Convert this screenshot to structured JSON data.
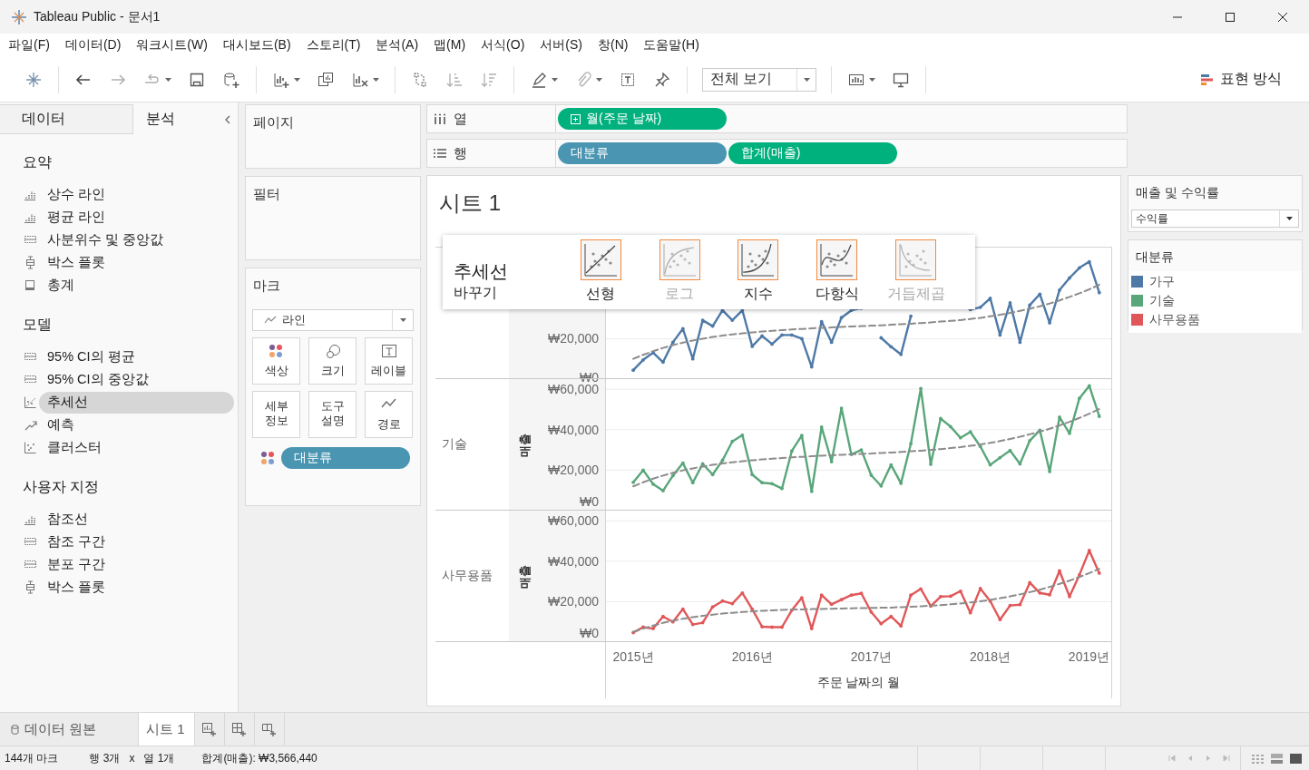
{
  "window": {
    "title": "Tableau Public - 문서1"
  },
  "menu": [
    {
      "label": "파일(F)"
    },
    {
      "label": "데이터(D)"
    },
    {
      "label": "워크시트(W)"
    },
    {
      "label": "대시보드(B)"
    },
    {
      "label": "스토리(T)"
    },
    {
      "label": "분석(A)"
    },
    {
      "label": "맵(M)"
    },
    {
      "label": "서식(O)"
    },
    {
      "label": "서버(S)"
    },
    {
      "label": "창(N)"
    },
    {
      "label": "도움말(H)"
    }
  ],
  "toolbar": {
    "view_dropdown": "전체 보기",
    "show_me": "표현 방식"
  },
  "side_tabs": [
    {
      "label": "데이터",
      "selected": false
    },
    {
      "label": "분석",
      "selected": true
    }
  ],
  "analytics": {
    "sections": [
      {
        "title": "요약",
        "items": [
          {
            "label": "상수 라인",
            "kind": "line",
            "selected": false
          },
          {
            "label": "평균 라인",
            "kind": "line",
            "selected": false
          },
          {
            "label": "사분위수 및 중앙값",
            "kind": "band",
            "selected": false
          },
          {
            "label": "박스 플롯",
            "kind": "box",
            "selected": false
          },
          {
            "label": "총계",
            "kind": "total",
            "selected": false
          }
        ]
      },
      {
        "title": "모델",
        "items": [
          {
            "label": "95% CI의 평균",
            "kind": "band",
            "selected": false
          },
          {
            "label": "95% CI의 중앙값",
            "kind": "band",
            "selected": false
          },
          {
            "label": "추세선",
            "kind": "trend",
            "selected": true
          },
          {
            "label": "예측",
            "kind": "forecast",
            "selected": false
          },
          {
            "label": "클러스터",
            "kind": "cluster",
            "selected": false
          }
        ]
      },
      {
        "title": "사용자 지정",
        "items": [
          {
            "label": "참조선",
            "kind": "line",
            "selected": false
          },
          {
            "label": "참조 구간",
            "kind": "band",
            "selected": false
          },
          {
            "label": "분포 구간",
            "kind": "band",
            "selected": false
          },
          {
            "label": "박스 플롯",
            "kind": "box",
            "selected": false
          }
        ]
      }
    ]
  },
  "pages": {
    "title": "페이지"
  },
  "filters": {
    "title": "필터"
  },
  "marks": {
    "title": "마크",
    "mark_type": "라인",
    "buttons": [
      {
        "label": "색상",
        "kind": "color"
      },
      {
        "label": "크기",
        "kind": "size"
      },
      {
        "label": "레이블",
        "kind": "label"
      },
      {
        "label": "세부\n정보",
        "kind": "detail"
      },
      {
        "label": "도구\n설명",
        "kind": "tooltip"
      },
      {
        "label": "경로",
        "kind": "path"
      }
    ],
    "pills": [
      {
        "label": "대분류",
        "kind": "discrete"
      }
    ]
  },
  "columns_shelf": {
    "label": "열",
    "pills": [
      {
        "label": "월(주문 날짜)",
        "kind": "continuous",
        "expandable": true
      }
    ]
  },
  "rows_shelf": {
    "label": "행",
    "pills": [
      {
        "label": "대분류",
        "kind": "discrete",
        "expandable": false
      },
      {
        "label": "합계(매출)",
        "kind": "continuous",
        "expandable": false
      }
    ]
  },
  "view": {
    "title": "시트 1",
    "panes": [
      {
        "chart_data": {
          "type": "line",
          "x": [
            2015,
            2015.083,
            2015.167,
            2015.25,
            2015.333,
            2015.417,
            2015.5,
            2015.583,
            2015.667,
            2015.75,
            2015.833,
            2015.917,
            2016,
            2016.083,
            2016.167,
            2016.25,
            2016.333,
            2016.417,
            2016.5,
            2016.583,
            2016.667,
            2016.75,
            2016.833,
            2016.917,
            2017,
            2017.083,
            2017.167,
            2017.25,
            2017.333,
            2017.417,
            2017.5,
            2017.583,
            2017.667,
            2017.75,
            2017.833,
            2017.917,
            2018,
            2018.083,
            2018.167,
            2018.25,
            2018.333,
            2018.417,
            2018.5,
            2018.583,
            2018.667,
            2018.75,
            2018.833,
            2018.917
          ],
          "xlim": [
            2014.763,
            2019.025
          ],
          "ylim": [
            0,
            65000
          ],
          "grid": true,
          "yticks": [
            {
              "value": 0,
              "label": "₩0"
            },
            {
              "value": 20000,
              "label": "₩20,000"
            }
          ],
          "series": [
            {
              "color": "#4e79a7",
              "line_style": "solid",
              "values": [
                4400,
                9500,
                13100,
                8400,
                18200,
                24900,
                10000,
                29100,
                26200,
                34000,
                29100,
                34000,
                16200,
                21300,
                17300,
                21800,
                21800,
                20000,
                6000,
                28400,
                18200,
                30400,
                34000,
                35000,
                null,
                20400,
                16000,
                12200,
                31100,
                null,
                null,
                null,
                null,
                null,
                34400,
                35500,
                40000,
                21800,
                37700,
                18200,
                36600,
                42000,
                27800,
                44000,
                50000,
                55000,
                58000,
                42700
              ]
            },
            {
              "color": "#8c8c8c",
              "line_style": "dashed",
              "values": [
                10000,
                12000,
                13800,
                15400,
                16800,
                18000,
                19100,
                20000,
                20800,
                21500,
                22100,
                22600,
                23100,
                23500,
                23900,
                24200,
                24500,
                24800,
                25100,
                25300,
                25500,
                25800,
                26000,
                26200,
                26400,
                26600,
                26900,
                27100,
                27400,
                27700,
                28000,
                28400,
                28800,
                29200,
                29700,
                30300,
                31000,
                31800,
                32700,
                33700,
                34800,
                36000,
                37400,
                38900,
                40600,
                42400,
                44400,
                46600
              ]
            }
          ]
        }
      },
      {
        "label": "기술",
        "chart_data": {
          "type": "line",
          "ylabel": "매출",
          "x": [
            2015,
            2015.083,
            2015.167,
            2015.25,
            2015.333,
            2015.417,
            2015.5,
            2015.583,
            2015.667,
            2015.75,
            2015.833,
            2015.917,
            2016,
            2016.083,
            2016.167,
            2016.25,
            2016.333,
            2016.417,
            2016.5,
            2016.583,
            2016.667,
            2016.75,
            2016.833,
            2016.917,
            2017,
            2017.083,
            2017.167,
            2017.25,
            2017.333,
            2017.417,
            2017.5,
            2017.583,
            2017.667,
            2017.75,
            2017.833,
            2017.917,
            2018,
            2018.083,
            2018.167,
            2018.25,
            2018.333,
            2018.417,
            2018.5,
            2018.583,
            2018.667,
            2018.75,
            2018.833,
            2018.917
          ],
          "xlim": [
            2014.763,
            2019.025
          ],
          "ylim": [
            0,
            65000
          ],
          "grid": true,
          "yticks": [
            {
              "value": 0,
              "label": "₩0"
            },
            {
              "value": 20000,
              "label": "₩20,000"
            },
            {
              "value": 40000,
              "label": "₩40,000"
            },
            {
              "value": 60000,
              "label": "₩60,000"
            }
          ],
          "series": [
            {
              "color": "#59a67a",
              "line_style": "solid",
              "values": [
                14000,
                20000,
                13100,
                9800,
                17300,
                23500,
                13800,
                23100,
                17800,
                24900,
                34200,
                37300,
                17800,
                13800,
                13300,
                10900,
                29500,
                37100,
                9500,
                41300,
                24200,
                50600,
                27800,
                30000,
                17500,
                12200,
                22600,
                13500,
                33100,
                60400,
                22900,
                45500,
                41500,
                36000,
                38900,
                31700,
                22600,
                26200,
                29700,
                23100,
                34600,
                39700,
                19300,
                46200,
                38200,
                55500,
                61700,
                46600
              ]
            },
            {
              "color": "#8c8c8c",
              "line_style": "dashed",
              "values": [
                12000,
                14000,
                15800,
                17300,
                18700,
                19900,
                20900,
                21800,
                22600,
                23300,
                23900,
                24400,
                24900,
                25300,
                25700,
                26000,
                26300,
                26600,
                26900,
                27100,
                27300,
                27600,
                27800,
                28000,
                28200,
                28500,
                28700,
                29000,
                29300,
                29600,
                30000,
                30400,
                30900,
                31400,
                32000,
                32700,
                33500,
                34400,
                35400,
                36500,
                37700,
                39000,
                40500,
                42100,
                43900,
                45800,
                47900,
                50200
              ]
            }
          ]
        }
      },
      {
        "label": "사무용품",
        "chart_data": {
          "type": "line",
          "xlabel": "주문 날짜의 월",
          "ylabel": "매출",
          "x": [
            2015,
            2015.083,
            2015.167,
            2015.25,
            2015.333,
            2015.417,
            2015.5,
            2015.583,
            2015.667,
            2015.75,
            2015.833,
            2015.917,
            2016,
            2016.083,
            2016.167,
            2016.25,
            2016.333,
            2016.417,
            2016.5,
            2016.583,
            2016.667,
            2016.75,
            2016.833,
            2016.917,
            2017,
            2017.083,
            2017.167,
            2017.25,
            2017.333,
            2017.417,
            2017.5,
            2017.583,
            2017.667,
            2017.75,
            2017.833,
            2017.917,
            2018,
            2018.083,
            2018.167,
            2018.25,
            2018.333,
            2018.417,
            2018.5,
            2018.583,
            2018.667,
            2018.75,
            2018.833,
            2018.917
          ],
          "xlim": [
            2014.763,
            2019.025
          ],
          "ylim": [
            0,
            65000
          ],
          "grid": true,
          "xticks": [
            {
              "value": 2015,
              "label": "2015년"
            },
            {
              "value": 2016,
              "label": "2016년"
            },
            {
              "value": 2017,
              "label": "2017년"
            },
            {
              "value": 2018,
              "label": "2018년"
            },
            {
              "value": 2019,
              "label": "2019년"
            }
          ],
          "yticks": [
            {
              "value": 0,
              "label": "₩0"
            },
            {
              "value": 20000,
              "label": "₩20,000"
            },
            {
              "value": 40000,
              "label": "₩40,000"
            },
            {
              "value": 60000,
              "label": "₩60,000"
            }
          ],
          "series": [
            {
              "color": "#e15759",
              "line_style": "solid",
              "values": [
                4700,
                7400,
                6700,
                12700,
                10000,
                16300,
                8700,
                9600,
                17400,
                20300,
                19000,
                24300,
                16300,
                7600,
                7400,
                7400,
                15800,
                21900,
                6700,
                23200,
                18700,
                21000,
                23200,
                24100,
                14900,
                9100,
                12700,
                8000,
                23200,
                26300,
                17800,
                22500,
                22700,
                25200,
                14500,
                26500,
                20300,
                11100,
                18100,
                18500,
                29400,
                24300,
                23400,
                35200,
                22500,
                33200,
                45300,
                34100
              ]
            },
            {
              "color": "#8c8c8c",
              "line_style": "dashed",
              "values": [
                5000,
                6700,
                8200,
                9500,
                10600,
                11500,
                12300,
                13000,
                13600,
                14100,
                14500,
                14900,
                15200,
                15500,
                15700,
                15900,
                16100,
                16200,
                16300,
                16400,
                16500,
                16600,
                16700,
                16800,
                16900,
                17000,
                17100,
                17300,
                17500,
                17700,
                18000,
                18300,
                18700,
                19100,
                19600,
                20200,
                20900,
                21700,
                22600,
                23600,
                24700,
                25900,
                27300,
                28800,
                30400,
                32200,
                34100,
                36200
              ]
            }
          ]
        }
      }
    ]
  },
  "trendline_popup": {
    "title": "추세선",
    "subtitle": "바꾸기",
    "options": [
      {
        "label": "선형",
        "kind": "linear",
        "disabled": false
      },
      {
        "label": "로그",
        "kind": "log",
        "disabled": true
      },
      {
        "label": "지수",
        "kind": "exponential",
        "disabled": false
      },
      {
        "label": "다항식",
        "kind": "polynomial",
        "disabled": false
      },
      {
        "label": "거듭제곱",
        "kind": "power",
        "disabled": true
      }
    ]
  },
  "measure_filter": {
    "title": "매출 및 수익률",
    "value": "수익률"
  },
  "color_legend": {
    "title": "대분류",
    "items": [
      {
        "label": "가구",
        "color": "#4e79a7"
      },
      {
        "label": "기술",
        "color": "#59a67a"
      },
      {
        "label": "사무용품",
        "color": "#e15759"
      }
    ]
  },
  "sheet_tabs": {
    "data_source": "데이터 원본",
    "sheets": [
      {
        "label": "시트 1",
        "selected": true
      }
    ]
  },
  "status_bar": {
    "marks": "144개 마크",
    "rows": "행 3개",
    "times": "x",
    "columns": "열 1개",
    "sum": "합계(매출): ₩3,566,440"
  }
}
